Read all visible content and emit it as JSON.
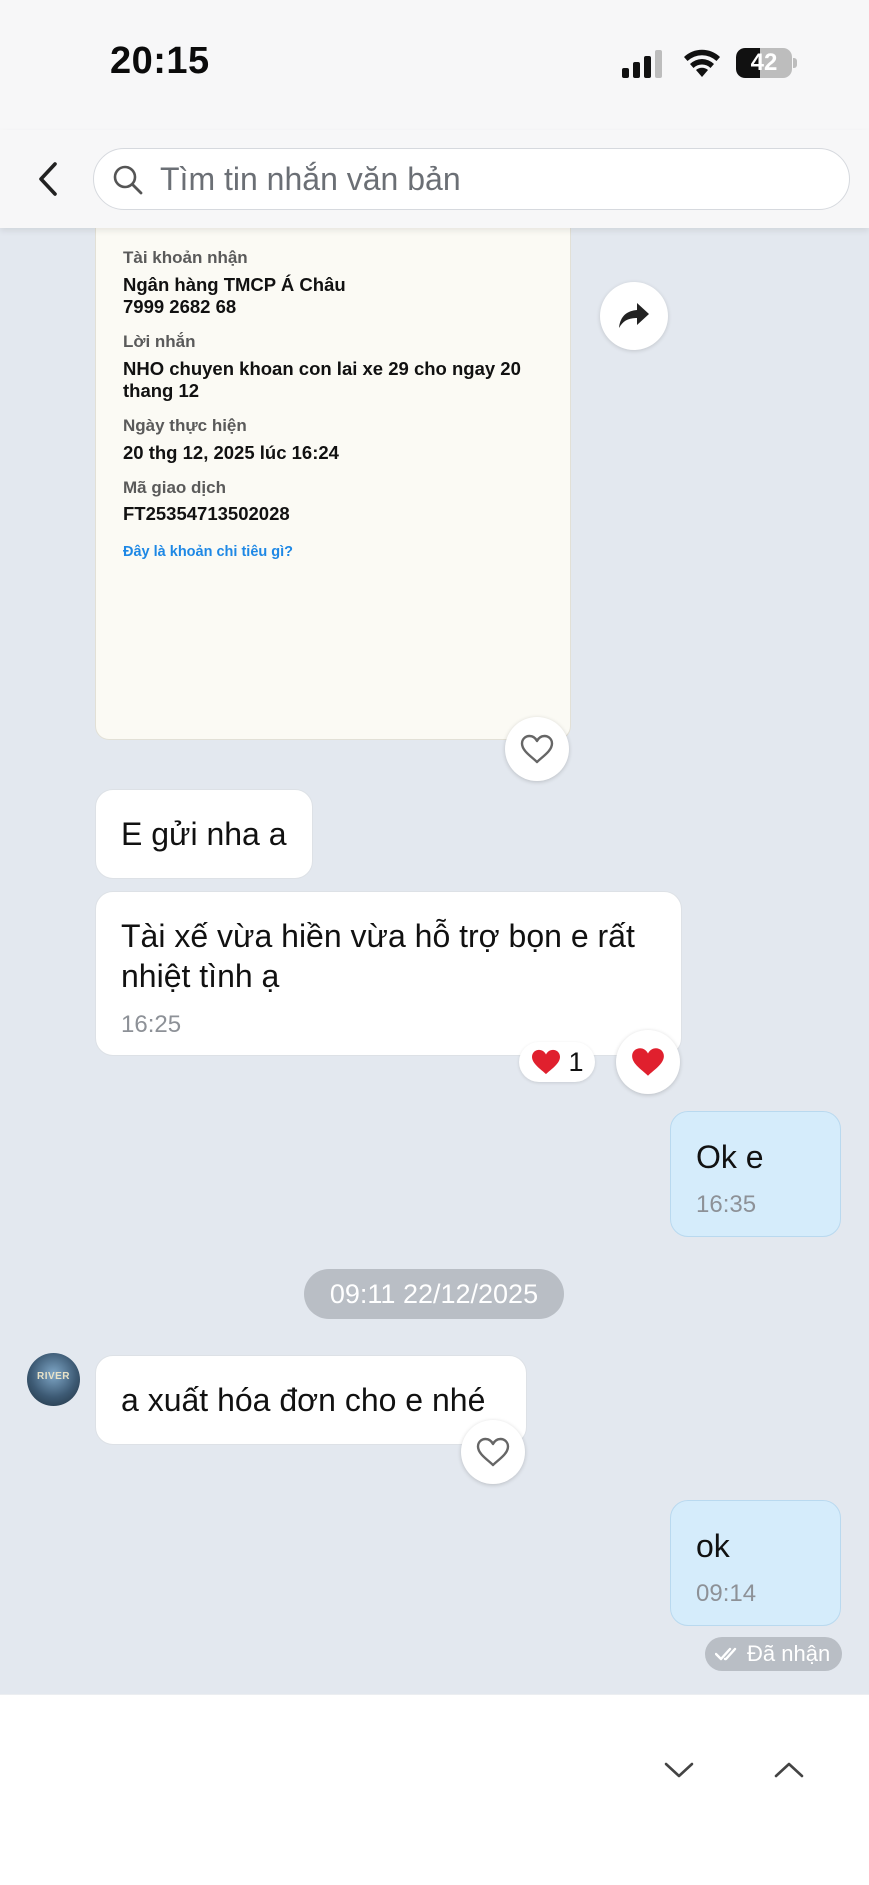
{
  "status_bar": {
    "time": "20:15",
    "battery": "42",
    "battery_level": 0.42
  },
  "search": {
    "placeholder": "Tìm tin nhắn văn bản"
  },
  "receipt": {
    "account_label": "Tài khoản nhận",
    "bank_name": "Ngân hàng TMCP Á Châu",
    "account_number": "7999 2682 68",
    "message_label": "Lời nhắn",
    "message_line1": "NHO chuyen khoan con lai xe 29 cho ngay 20",
    "message_line2": "thang 12",
    "date_label": "Ngày thực hiện",
    "date_value": "20 thg 12, 2025 lúc 16:24",
    "txn_label": "Mã giao dịch",
    "txn_value": "FT25354713502028",
    "link": "Đây là khoản chi tiêu gì?"
  },
  "messages": [
    {
      "text": "E gửi nha a"
    },
    {
      "text_line1": "Tài xế vừa hiền vừa hỗ trợ bọn e rất",
      "text_line2": "nhiệt tình ạ",
      "time": "16:25",
      "reaction_count": "1"
    },
    {
      "text": "Ok e",
      "time": "16:35"
    },
    {
      "text": "a xuất hóa đơn cho e nhé"
    },
    {
      "text": "ok",
      "time": "09:14"
    }
  ],
  "date_separator": "09:11 22/12/2025",
  "avatar_text": "RIVER",
  "delivered": "Đã nhận",
  "colors": {
    "my_bubble": "#d5ecfb",
    "heart": "#e0202e",
    "link": "#1e88e5"
  }
}
